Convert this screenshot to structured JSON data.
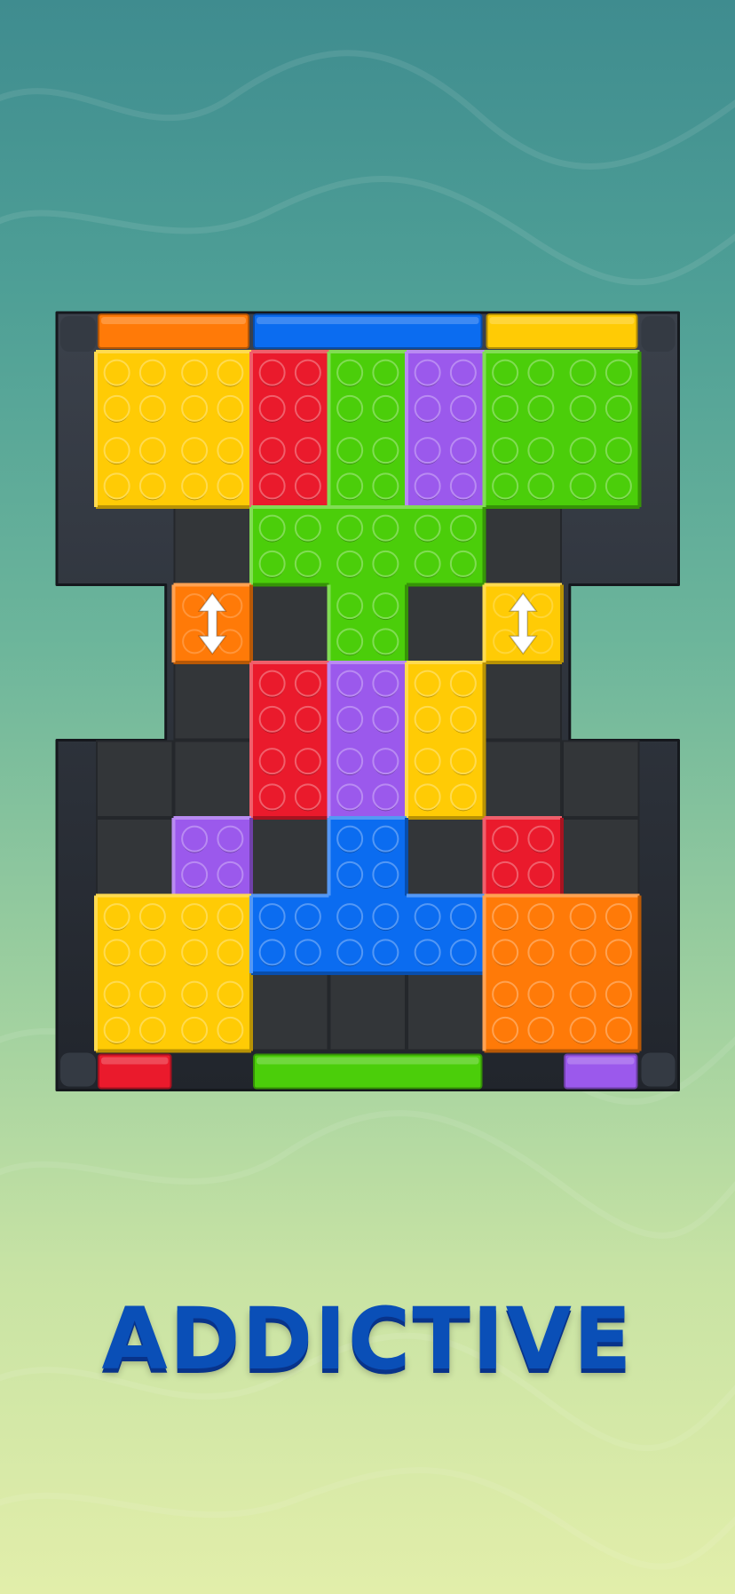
{
  "caption": "ADDICTIVE",
  "colors": {
    "yellow": "#ffcb05",
    "red": "#ea1a2c",
    "green": "#4bce0a",
    "purple": "#9b59ec",
    "orange": "#ff7a08",
    "blue": "#0b6cf0",
    "frame": "#2a2f37",
    "cell": "#333639"
  },
  "grid": {
    "cols": 7,
    "rows": 9
  },
  "board_cells": [
    [
      0,
      0
    ],
    [
      1,
      0
    ],
    [
      2,
      0
    ],
    [
      3,
      0
    ],
    [
      4,
      0
    ],
    [
      5,
      0
    ],
    [
      6,
      0
    ],
    [
      0,
      1
    ],
    [
      1,
      1
    ],
    [
      2,
      1
    ],
    [
      3,
      1
    ],
    [
      4,
      1
    ],
    [
      5,
      1
    ],
    [
      6,
      1
    ],
    [
      1,
      2
    ],
    [
      2,
      2
    ],
    [
      3,
      2
    ],
    [
      4,
      2
    ],
    [
      5,
      2
    ],
    [
      1,
      3
    ],
    [
      2,
      3
    ],
    [
      3,
      3
    ],
    [
      4,
      3
    ],
    [
      5,
      3
    ],
    [
      1,
      4
    ],
    [
      2,
      4
    ],
    [
      3,
      4
    ],
    [
      4,
      4
    ],
    [
      5,
      4
    ],
    [
      0,
      5
    ],
    [
      1,
      5
    ],
    [
      2,
      5
    ],
    [
      3,
      5
    ],
    [
      4,
      5
    ],
    [
      5,
      5
    ],
    [
      6,
      5
    ],
    [
      0,
      6
    ],
    [
      1,
      6
    ],
    [
      2,
      6
    ],
    [
      3,
      6
    ],
    [
      4,
      6
    ],
    [
      5,
      6
    ],
    [
      6,
      6
    ],
    [
      0,
      7
    ],
    [
      1,
      7
    ],
    [
      2,
      7
    ],
    [
      3,
      7
    ],
    [
      4,
      7
    ],
    [
      5,
      7
    ],
    [
      6,
      7
    ]
  ],
  "exits": [
    {
      "side": "top",
      "color": "orange",
      "from": 0,
      "len": 2
    },
    {
      "side": "top",
      "color": "blue",
      "from": 2,
      "len": 3
    },
    {
      "side": "top",
      "color": "yellow",
      "from": 5,
      "len": 2
    },
    {
      "side": "bottom",
      "color": "red",
      "from": 0,
      "len": 1
    },
    {
      "side": "bottom",
      "color": "green",
      "from": 2,
      "len": 3
    },
    {
      "side": "bottom",
      "color": "purple",
      "from": 6,
      "len": 1
    }
  ],
  "pieces": [
    {
      "name": "yellow-block-top-left",
      "color": "yellow",
      "cells": [
        [
          0,
          0
        ],
        [
          1,
          0
        ],
        [
          0,
          1
        ],
        [
          1,
          1
        ]
      ]
    },
    {
      "name": "red-block-top",
      "color": "red",
      "cells": [
        [
          2,
          0
        ],
        [
          2,
          1
        ]
      ]
    },
    {
      "name": "green-block-top",
      "color": "green",
      "cells": [
        [
          3,
          0
        ],
        [
          3,
          1
        ]
      ]
    },
    {
      "name": "purple-block-top",
      "color": "purple",
      "cells": [
        [
          4,
          0
        ],
        [
          4,
          1
        ]
      ]
    },
    {
      "name": "green-block-top-right",
      "color": "green",
      "cells": [
        [
          5,
          0
        ],
        [
          6,
          0
        ],
        [
          5,
          1
        ],
        [
          6,
          1
        ]
      ]
    },
    {
      "name": "green-t-block",
      "color": "green",
      "cells": [
        [
          2,
          2
        ],
        [
          3,
          2
        ],
        [
          4,
          2
        ],
        [
          3,
          3
        ]
      ]
    },
    {
      "name": "orange-small-block",
      "color": "orange",
      "cells": [
        [
          1,
          3
        ]
      ],
      "arrow": "vertical"
    },
    {
      "name": "yellow-small-block",
      "color": "yellow",
      "cells": [
        [
          5,
          3
        ]
      ],
      "arrow": "vertical"
    },
    {
      "name": "red-block-middle",
      "color": "red",
      "cells": [
        [
          2,
          4
        ],
        [
          2,
          5
        ]
      ]
    },
    {
      "name": "purple-block-middle",
      "color": "purple",
      "cells": [
        [
          3,
          4
        ],
        [
          3,
          5
        ]
      ]
    },
    {
      "name": "yellow-block-middle",
      "color": "yellow",
      "cells": [
        [
          4,
          4
        ],
        [
          4,
          5
        ]
      ]
    },
    {
      "name": "purple-small-block",
      "color": "purple",
      "cells": [
        [
          1,
          6
        ]
      ]
    },
    {
      "name": "red-small-block",
      "color": "red",
      "cells": [
        [
          5,
          6
        ]
      ]
    },
    {
      "name": "yellow-block-bottom-left",
      "color": "yellow",
      "cells": [
        [
          0,
          7
        ],
        [
          1,
          7
        ],
        [
          0,
          8
        ],
        [
          1,
          8
        ]
      ]
    },
    {
      "name": "blue-t-block",
      "color": "blue",
      "cells": [
        [
          3,
          6
        ],
        [
          2,
          7
        ],
        [
          3,
          7
        ],
        [
          4,
          7
        ]
      ]
    },
    {
      "name": "orange-block-bottom-right",
      "color": "orange",
      "cells": [
        [
          5,
          7
        ],
        [
          6,
          7
        ],
        [
          5,
          8
        ],
        [
          6,
          8
        ]
      ]
    }
  ]
}
